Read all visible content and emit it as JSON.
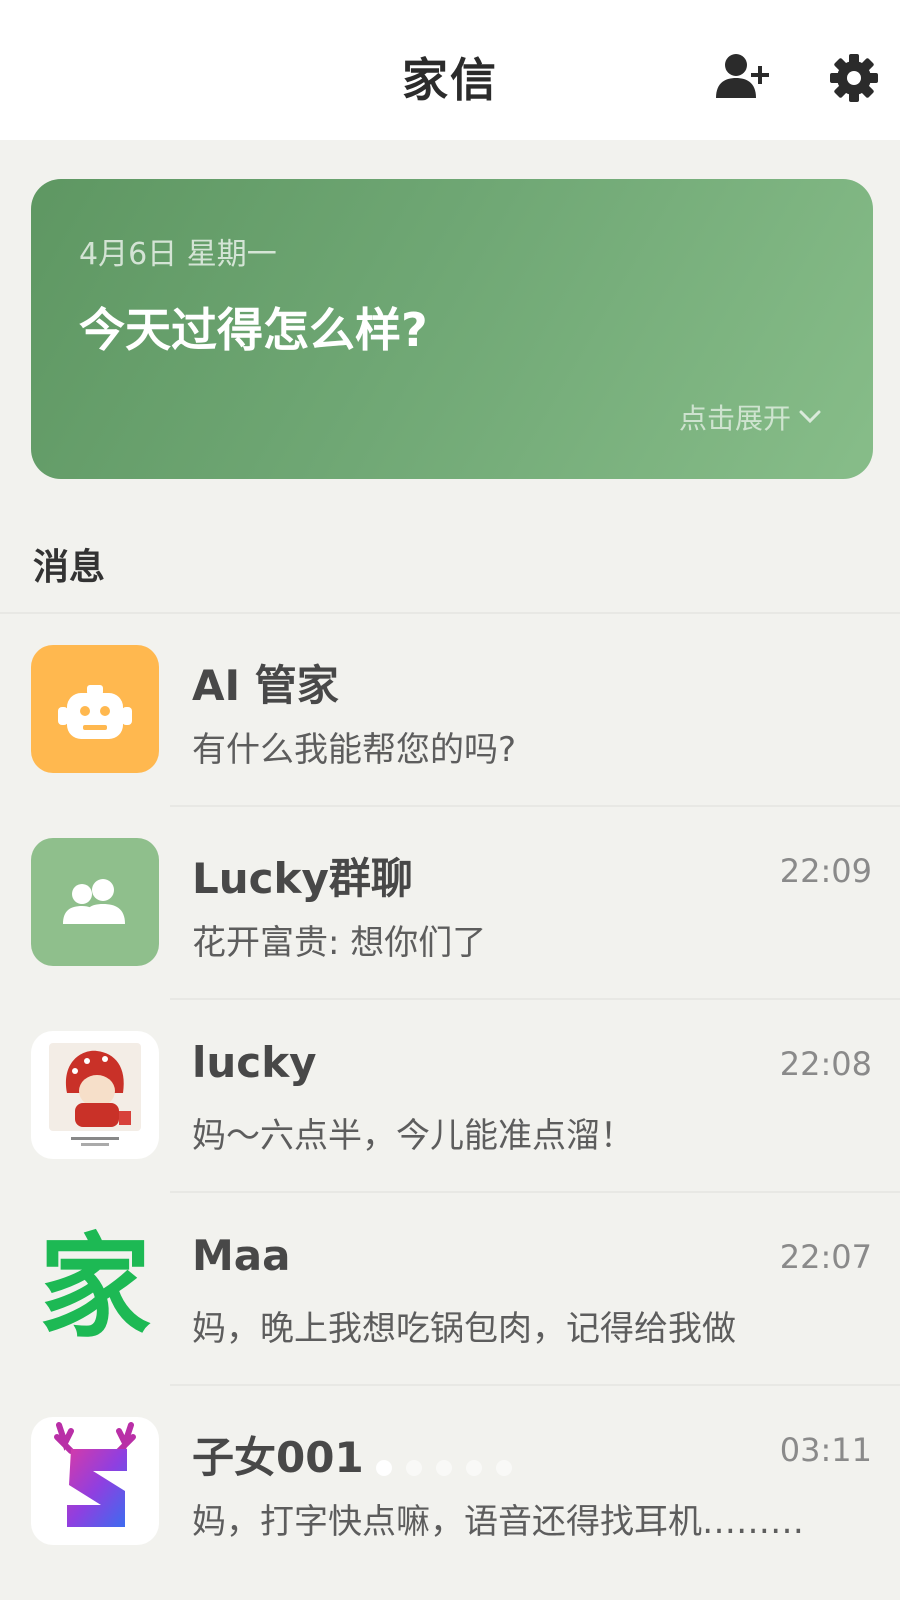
{
  "header": {
    "title": "家信",
    "add_friend_icon": "person-add-icon",
    "settings_icon": "gear-icon"
  },
  "banner": {
    "date": "4月6日 星期一",
    "question": "今天过得怎么样?",
    "expand_label": "点击展开",
    "expand_icon": "chevron-down-icon",
    "gradient": [
      "#5e9762",
      "#87bd89"
    ]
  },
  "messages_section": {
    "title": "消息"
  },
  "conversations": [
    {
      "name": "AI 管家",
      "preview": "有什么我能帮您的吗?",
      "time": "",
      "avatar": "robot-icon",
      "avatar_color": "#ffb84f"
    },
    {
      "name": "Lucky群聊",
      "preview": "花开富贵: 想你们了",
      "time": "22:09",
      "avatar": "group-icon",
      "avatar_color": "#8fbf8c"
    },
    {
      "name": "lucky",
      "preview": "妈～六点半，今儿能准点溜！",
      "time": "22:08",
      "avatar": "photo-avatar",
      "avatar_color": "#ffffff"
    },
    {
      "name": "Maa",
      "preview": "妈，晚上我想吃锅包肉，记得给我做",
      "time": "22:07",
      "avatar": "jia-logo",
      "avatar_text": "家",
      "avatar_color": "#1db954"
    },
    {
      "name": "子女001",
      "preview": "妈，打字快点嘛，语音还得找耳机………",
      "time": "03:11",
      "avatar": "antler-s-logo",
      "avatar_color": "#ffffff"
    }
  ],
  "colors": {
    "accent": "#6aa36e",
    "background": "#f2f2ee"
  }
}
